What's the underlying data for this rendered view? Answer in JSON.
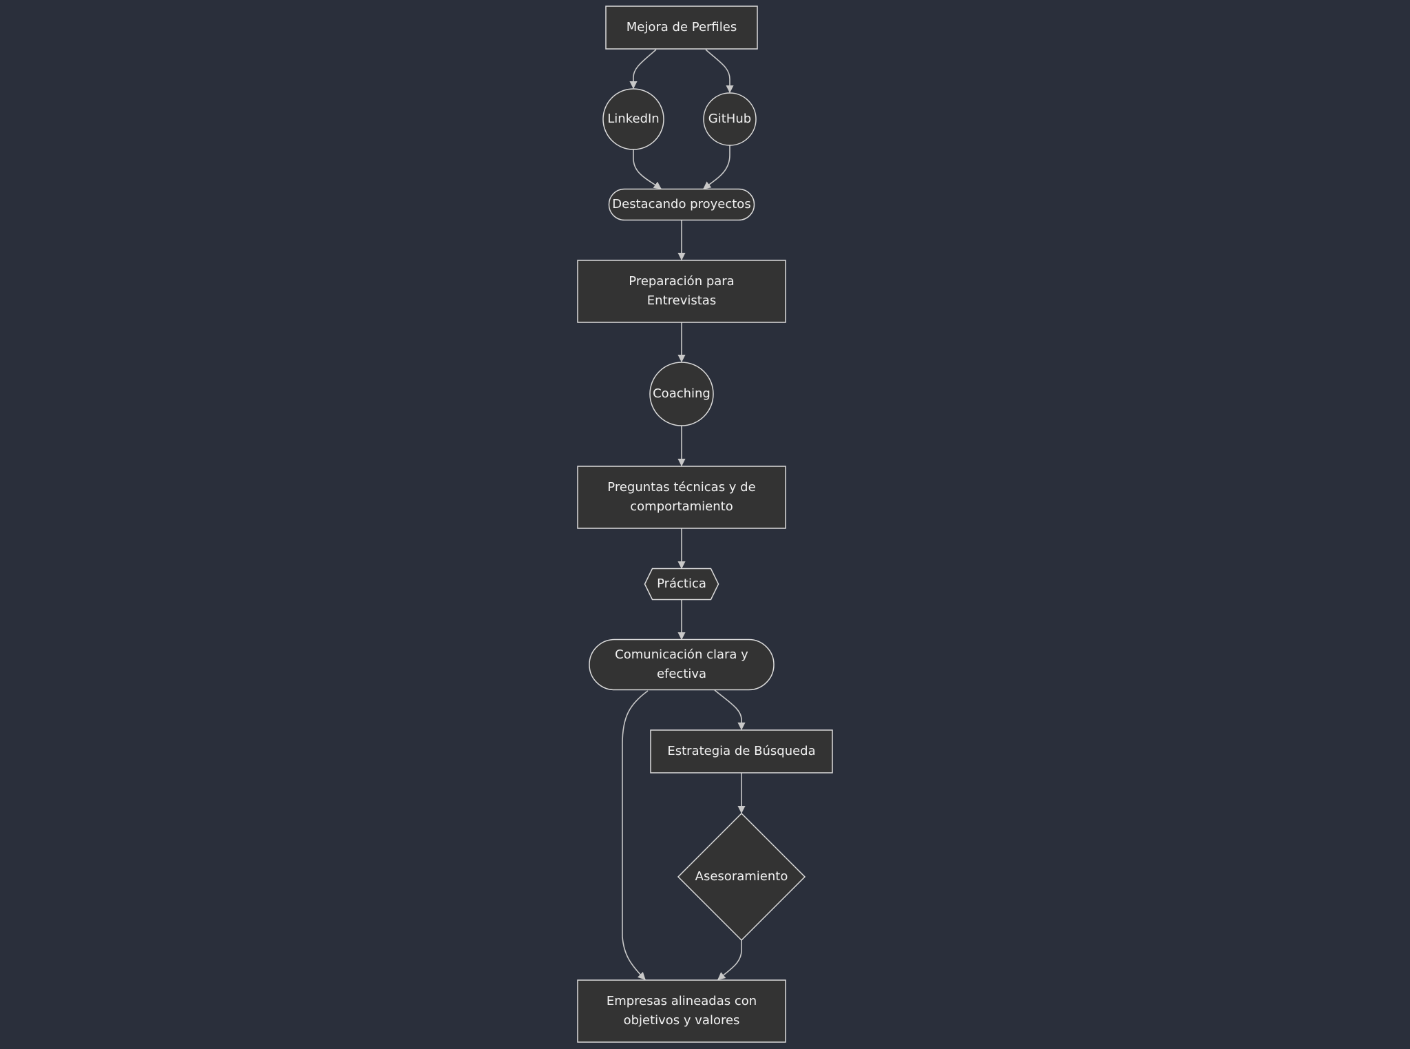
{
  "diagram": {
    "type": "flowchart",
    "direction": "top-down",
    "colors": {
      "background": "#2a2f3b",
      "node_fill": "#333333",
      "node_stroke": "#dcdcdc",
      "edge": "#c8c8c8",
      "text": "#f2f2f2"
    },
    "nodes": [
      {
        "id": "perfiles",
        "shape": "rect",
        "lines": [
          "Mejora de Perfiles"
        ]
      },
      {
        "id": "linkedin",
        "shape": "circle",
        "lines": [
          "LinkedIn"
        ]
      },
      {
        "id": "github",
        "shape": "circle",
        "lines": [
          "GitHub"
        ]
      },
      {
        "id": "destacando",
        "shape": "stadium",
        "lines": [
          "Destacando proyectos"
        ]
      },
      {
        "id": "preparacion",
        "shape": "rect",
        "lines": [
          "Preparación para",
          "Entrevistas"
        ]
      },
      {
        "id": "coaching",
        "shape": "circle",
        "lines": [
          "Coaching"
        ]
      },
      {
        "id": "preguntas",
        "shape": "rect",
        "lines": [
          "Preguntas técnicas y de",
          "comportamiento"
        ]
      },
      {
        "id": "practica",
        "shape": "hexagon",
        "lines": [
          "Práctica"
        ]
      },
      {
        "id": "comunicacion",
        "shape": "stadium",
        "lines": [
          "Comunicación clara y",
          "efectiva"
        ]
      },
      {
        "id": "estrategia",
        "shape": "rect",
        "lines": [
          "Estrategia de Búsqueda"
        ]
      },
      {
        "id": "asesoramiento",
        "shape": "diamond",
        "lines": [
          "Asesoramiento"
        ]
      },
      {
        "id": "empresas",
        "shape": "rect",
        "lines": [
          "Empresas alineadas con",
          "objetivos y valores"
        ]
      }
    ],
    "edges": [
      {
        "from": "perfiles",
        "to": "linkedin"
      },
      {
        "from": "perfiles",
        "to": "github"
      },
      {
        "from": "linkedin",
        "to": "destacando"
      },
      {
        "from": "github",
        "to": "destacando"
      },
      {
        "from": "destacando",
        "to": "preparacion"
      },
      {
        "from": "preparacion",
        "to": "coaching"
      },
      {
        "from": "coaching",
        "to": "preguntas"
      },
      {
        "from": "preguntas",
        "to": "practica"
      },
      {
        "from": "practica",
        "to": "comunicacion"
      },
      {
        "from": "comunicacion",
        "to": "estrategia"
      },
      {
        "from": "comunicacion",
        "to": "empresas"
      },
      {
        "from": "estrategia",
        "to": "asesoramiento"
      },
      {
        "from": "asesoramiento",
        "to": "empresas"
      }
    ]
  }
}
